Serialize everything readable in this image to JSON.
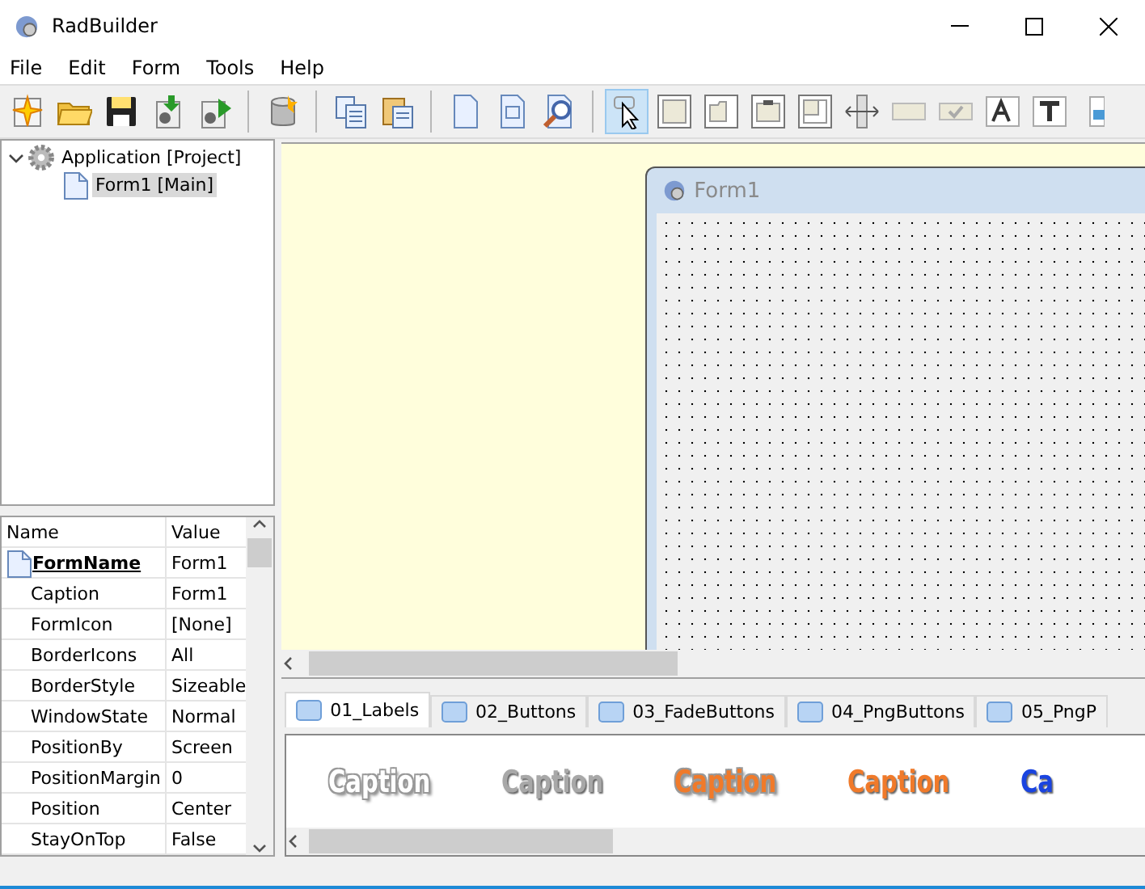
{
  "window": {
    "title": "RadBuilder"
  },
  "menu": [
    {
      "label": "File"
    },
    {
      "label": "Edit"
    },
    {
      "label": "Form"
    },
    {
      "label": "Tools"
    },
    {
      "label": "Help"
    }
  ],
  "toolbar": [
    {
      "kind": "new",
      "selected": false
    },
    {
      "kind": "open",
      "selected": false
    },
    {
      "kind": "save",
      "selected": false
    },
    {
      "kind": "build",
      "selected": false
    },
    {
      "kind": "run",
      "selected": false
    },
    {
      "kind": "separator"
    },
    {
      "kind": "database",
      "selected": false
    },
    {
      "kind": "separator"
    },
    {
      "kind": "copy",
      "selected": false
    },
    {
      "kind": "paste",
      "selected": false
    },
    {
      "kind": "separator"
    },
    {
      "kind": "page",
      "selected": false
    },
    {
      "kind": "window",
      "selected": false
    },
    {
      "kind": "zoom",
      "selected": false
    },
    {
      "kind": "separator"
    },
    {
      "kind": "pointer",
      "selected": true
    },
    {
      "kind": "panel",
      "selected": false
    },
    {
      "kind": "tabpanel",
      "selected": false
    },
    {
      "kind": "groupbox",
      "selected": false
    },
    {
      "kind": "grid",
      "selected": false
    },
    {
      "kind": "splitter",
      "selected": false
    },
    {
      "kind": "okbutton",
      "selected": false
    },
    {
      "kind": "checkbutton",
      "selected": false
    },
    {
      "kind": "fontlabel",
      "selected": false
    },
    {
      "kind": "textlabel",
      "selected": false
    },
    {
      "kind": "image",
      "selected": false
    }
  ],
  "tree": [
    {
      "label": "Application [Project]",
      "expanded": true,
      "selected": false,
      "children": [
        {
          "label": "Form1 [Main]",
          "selected": true
        }
      ]
    }
  ],
  "properties": {
    "columns": [
      "Name",
      "Value"
    ],
    "rows": [
      {
        "name": "FormName",
        "value": "Form1",
        "kind": "key"
      },
      {
        "name": "Caption",
        "value": "Form1",
        "kind": "plain"
      },
      {
        "name": "FormIcon",
        "value": "[None]",
        "kind": "plain"
      },
      {
        "name": "BorderIcons",
        "value": "All",
        "kind": "plain"
      },
      {
        "name": "BorderStyle",
        "value": "Sizeable",
        "kind": "plain"
      },
      {
        "name": "WindowState",
        "value": "Normal",
        "kind": "plain"
      },
      {
        "name": "PositionBy",
        "value": "Screen",
        "kind": "plain"
      },
      {
        "name": "PositionMargin",
        "value": "0",
        "kind": "plain"
      },
      {
        "name": "Position",
        "value": "Center",
        "kind": "plain"
      },
      {
        "name": "StayOnTop",
        "value": "False",
        "kind": "plain"
      }
    ]
  },
  "designer": {
    "form_title": "Form1"
  },
  "tabs": [
    {
      "label": "01_Labels",
      "selected": true
    },
    {
      "label": "02_Buttons",
      "selected": false
    },
    {
      "label": "03_FadeButtons",
      "selected": false
    },
    {
      "label": "04_PngButtons",
      "selected": false
    },
    {
      "label": "05_PngP",
      "selected": false
    }
  ],
  "samples": [
    {
      "text": "Caption",
      "kind": "outline",
      "color": "#ffffff"
    },
    {
      "text": "Caption",
      "kind": "solid",
      "color": "#a8a8a8"
    },
    {
      "text": "Caption",
      "kind": "outline",
      "color": "#f07a2a"
    },
    {
      "text": "Caption",
      "kind": "solid",
      "color": "#f07a2a"
    },
    {
      "text": "Ca",
      "kind": "solid",
      "color": "#1a44e0"
    }
  ]
}
